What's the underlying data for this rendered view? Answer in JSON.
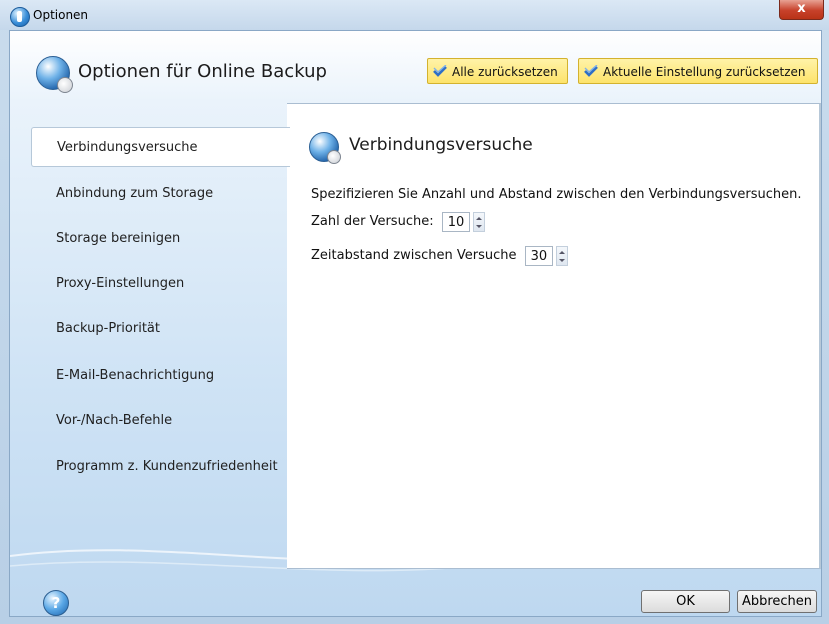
{
  "window": {
    "title": "Optionen",
    "close_label": "x"
  },
  "header": {
    "title": "Optionen für Online Backup",
    "reset_all": "Alle zurücksetzen",
    "reset_current": "Aktuelle Einstellung zurücksetzen"
  },
  "sidebar": {
    "items": [
      {
        "label": "Verbindungsversuche",
        "active": true
      },
      {
        "label": "Anbindung zum Storage"
      },
      {
        "label": "Storage bereinigen"
      },
      {
        "label": "Proxy-Einstellungen"
      },
      {
        "label": "Backup-Priorität"
      },
      {
        "label": "E-Mail-Benachrichtigung"
      },
      {
        "label": "Vor-/Nach-Befehle"
      },
      {
        "label": "Programm z. Kundenzufriedenheit"
      }
    ]
  },
  "panel": {
    "title": "Verbindungsversuche",
    "description": "Spezifizieren Sie Anzahl und Abstand zwischen den Verbindungsversuchen.",
    "attempts_label": "Zahl der Versuche:",
    "attempts_value": "10",
    "interval_label": "Zeitabstand zwischen Versuche",
    "interval_value": "30"
  },
  "footer": {
    "ok": "OK",
    "cancel": "Abbrechen",
    "help_glyph": "?"
  },
  "colors": {
    "accent_yellow": "#fde36b",
    "window_blue": "#c5d8eb"
  }
}
